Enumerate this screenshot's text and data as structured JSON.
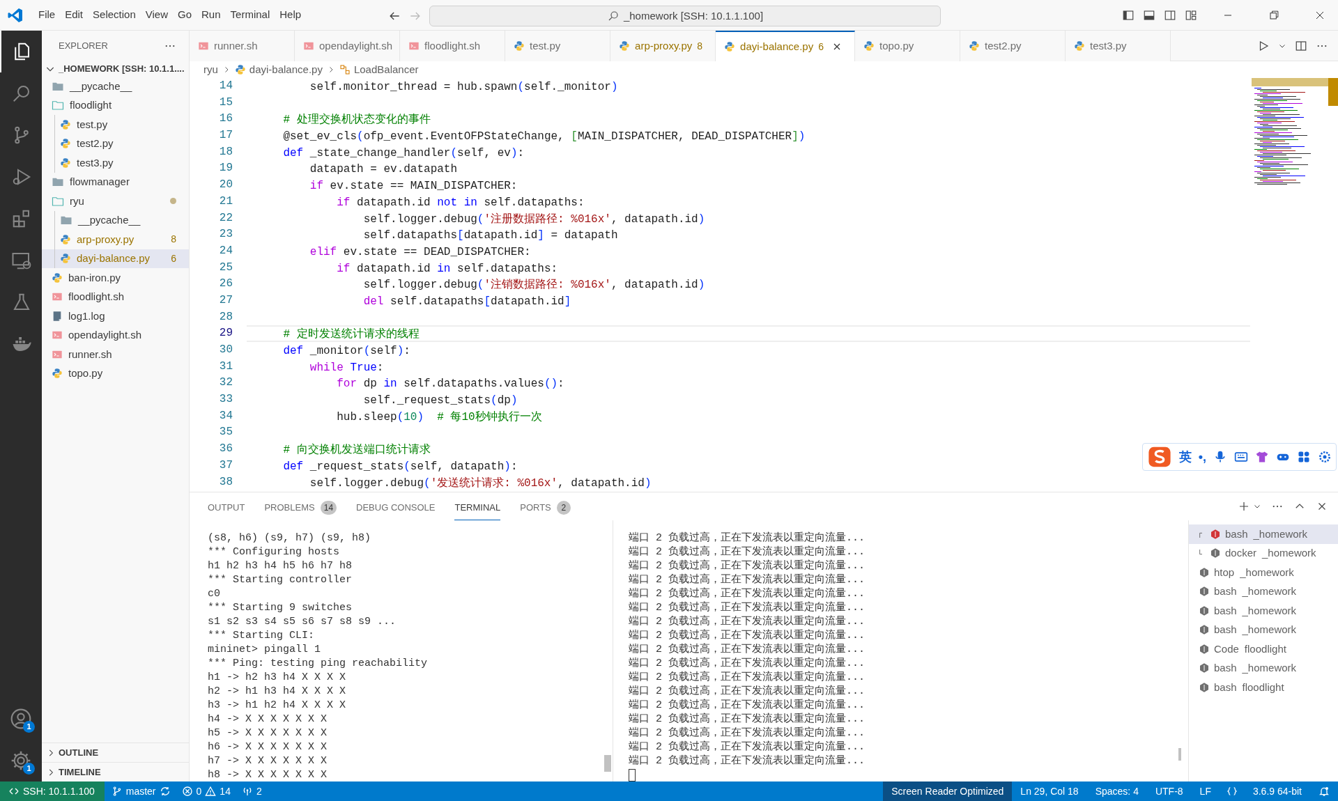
{
  "title_bar": {
    "menu": [
      "File",
      "Edit",
      "Selection",
      "View",
      "Go",
      "Run",
      "Terminal",
      "Help"
    ],
    "command_center": "_homework [SSH: 10.1.1.100]"
  },
  "activity_bar": [
    {
      "kind": "explorer",
      "selected": true
    },
    {
      "kind": "search",
      "selected": false
    },
    {
      "kind": "source-control",
      "selected": false
    },
    {
      "kind": "run",
      "selected": false
    },
    {
      "kind": "extensions",
      "selected": false
    },
    {
      "kind": "remote",
      "selected": false
    },
    {
      "kind": "testing",
      "selected": false
    },
    {
      "kind": "docker",
      "selected": false
    }
  ],
  "activity_bottom": [
    {
      "kind": "accounts",
      "badge": "1"
    },
    {
      "kind": "settings",
      "badge": "1"
    }
  ],
  "sidebar": {
    "title": "EXPLORER",
    "root": "_HOMEWORK [SSH: 10.1.1....",
    "tree": [
      {
        "label": "__pycache__",
        "kind": "folder",
        "expanded": false,
        "selected": false,
        "warning": false,
        "modified": false
      },
      {
        "label": "floodlight",
        "kind": "folder",
        "expanded": true,
        "selected": false,
        "warning": false,
        "modified": false,
        "children": [
          {
            "label": "test.py",
            "kind": "python",
            "selected": false,
            "warning": false,
            "modified": false
          },
          {
            "label": "test2.py",
            "kind": "python",
            "selected": false,
            "warning": false,
            "modified": false
          },
          {
            "label": "test3.py",
            "kind": "python",
            "selected": false,
            "warning": false,
            "modified": false
          }
        ]
      },
      {
        "label": "flowmanager",
        "kind": "folder",
        "expanded": false,
        "selected": false,
        "warning": false,
        "modified": false
      },
      {
        "label": "ryu",
        "kind": "folder",
        "expanded": true,
        "selected": false,
        "warning": false,
        "modified": true,
        "children": [
          {
            "label": "__pycache__",
            "kind": "folder",
            "expanded": false,
            "selected": false,
            "warning": false,
            "modified": false
          },
          {
            "label": "arp-proxy.py",
            "kind": "python",
            "selected": false,
            "warning": true,
            "modified": false,
            "badge": "8"
          },
          {
            "label": "dayi-balance.py",
            "kind": "python",
            "selected": true,
            "warning": true,
            "modified": false,
            "badge": "6"
          }
        ]
      },
      {
        "label": "ban-iron.py",
        "kind": "python",
        "selected": false,
        "warning": false,
        "modified": false
      },
      {
        "label": "floodlight.sh",
        "kind": "shell",
        "selected": false,
        "warning": false,
        "modified": false
      },
      {
        "label": "log1.log",
        "kind": "log",
        "selected": false,
        "warning": false,
        "modified": false
      },
      {
        "label": "opendaylight.sh",
        "kind": "shell",
        "selected": false,
        "warning": false,
        "modified": false
      },
      {
        "label": "runner.sh",
        "kind": "shell",
        "selected": false,
        "warning": false,
        "modified": false
      },
      {
        "label": "topo.py",
        "kind": "python",
        "selected": false,
        "warning": false,
        "modified": false
      }
    ],
    "sections": [
      "OUTLINE",
      "TIMELINE"
    ]
  },
  "tabs": [
    {
      "label": "runner.sh",
      "kind": "shell",
      "selected": false,
      "warning": false
    },
    {
      "label": "opendaylight.sh",
      "kind": "shell",
      "selected": false,
      "warning": false
    },
    {
      "label": "floodlight.sh",
      "kind": "shell",
      "selected": false,
      "warning": false
    },
    {
      "label": "test.py",
      "kind": "python",
      "selected": false,
      "warning": false
    },
    {
      "label": "arp-proxy.py",
      "kind": "python",
      "selected": false,
      "warning": true,
      "badge": "8"
    },
    {
      "label": "dayi-balance.py",
      "kind": "python",
      "selected": true,
      "warning": true,
      "badge": "6"
    },
    {
      "label": "topo.py",
      "kind": "python",
      "selected": false,
      "warning": false
    },
    {
      "label": "test2.py",
      "kind": "python",
      "selected": false,
      "warning": false
    },
    {
      "label": "test3.py",
      "kind": "python",
      "selected": false,
      "warning": false
    }
  ],
  "breadcrumb": [
    {
      "label": "ryu"
    },
    {
      "label": "dayi-balance.py",
      "kind": "python"
    },
    {
      "label": "LoadBalancer",
      "kind": "class"
    }
  ],
  "editor": {
    "lines": [
      {
        "number": "14",
        "current": false,
        "tokens": [
          {
            "kind": "plain",
            "text": "        self.monitor_thread = hub.spawn"
          },
          {
            "kind": "br",
            "text": "("
          },
          {
            "kind": "plain",
            "text": "self._monitor"
          },
          {
            "kind": "br",
            "text": ")"
          }
        ]
      },
      {
        "number": "15",
        "current": false
      },
      {
        "number": "16",
        "current": false,
        "tokens": [
          {
            "kind": "com",
            "text": "    # 处理交换机状态变化的事件"
          }
        ]
      },
      {
        "number": "17",
        "current": false,
        "tokens": [
          {
            "kind": "plain",
            "text": "    @set_ev_cls"
          },
          {
            "kind": "br",
            "text": "("
          },
          {
            "kind": "plain",
            "text": "ofp_event.EventOFPStateChange, "
          },
          {
            "kind": "br2",
            "text": "["
          },
          {
            "kind": "plain",
            "text": "MAIN_DISPATCHER, DEAD_DISPATCHER"
          },
          {
            "kind": "br2",
            "text": "]"
          },
          {
            "kind": "br",
            "text": ")"
          }
        ]
      },
      {
        "number": "18",
        "current": false,
        "tokens": [
          {
            "kind": "kw",
            "text": "    def"
          },
          {
            "kind": "plain",
            "text": " _state_change_handler"
          },
          {
            "kind": "br",
            "text": "("
          },
          {
            "kind": "plain",
            "text": "self, ev"
          },
          {
            "kind": "br",
            "text": ")"
          },
          {
            "kind": "plain",
            "text": ":"
          }
        ]
      },
      {
        "number": "19",
        "current": false,
        "tokens": [
          {
            "kind": "plain",
            "text": "        datapath = ev.datapath"
          }
        ]
      },
      {
        "number": "20",
        "current": false,
        "tokens": [
          {
            "kind": "ctl",
            "text": "        if"
          },
          {
            "kind": "plain",
            "text": " ev.state == MAIN_DISPATCHER:"
          }
        ]
      },
      {
        "number": "21",
        "current": false,
        "tokens": [
          {
            "kind": "ctl",
            "text": "            if"
          },
          {
            "kind": "plain",
            "text": " datapath.id "
          },
          {
            "kind": "kw",
            "text": "not in"
          },
          {
            "kind": "plain",
            "text": " self.datapaths:"
          }
        ]
      },
      {
        "number": "22",
        "current": false,
        "tokens": [
          {
            "kind": "plain",
            "text": "                self.logger.debug"
          },
          {
            "kind": "br",
            "text": "("
          },
          {
            "kind": "str",
            "text": "'注册数据路径: %016x'"
          },
          {
            "kind": "plain",
            "text": ", datapath.id"
          },
          {
            "kind": "br",
            "text": ")"
          }
        ]
      },
      {
        "number": "23",
        "current": false,
        "tokens": [
          {
            "kind": "plain",
            "text": "                self.datapaths"
          },
          {
            "kind": "br",
            "text": "["
          },
          {
            "kind": "plain",
            "text": "datapath.id"
          },
          {
            "kind": "br",
            "text": "]"
          },
          {
            "kind": "plain",
            "text": " = datapath"
          }
        ]
      },
      {
        "number": "24",
        "current": false,
        "tokens": [
          {
            "kind": "ctl",
            "text": "        elif"
          },
          {
            "kind": "plain",
            "text": " ev.state == DEAD_DISPATCHER:"
          }
        ]
      },
      {
        "number": "25",
        "current": false,
        "tokens": [
          {
            "kind": "ctl",
            "text": "            if"
          },
          {
            "kind": "plain",
            "text": " datapath.id "
          },
          {
            "kind": "kw",
            "text": "in"
          },
          {
            "kind": "plain",
            "text": " self.datapaths:"
          }
        ]
      },
      {
        "number": "26",
        "current": false,
        "tokens": [
          {
            "kind": "plain",
            "text": "                self.logger.debug"
          },
          {
            "kind": "br",
            "text": "("
          },
          {
            "kind": "str",
            "text": "'注销数据路径: %016x'"
          },
          {
            "kind": "plain",
            "text": ", datapath.id"
          },
          {
            "kind": "br",
            "text": ")"
          }
        ]
      },
      {
        "number": "27",
        "current": false,
        "tokens": [
          {
            "kind": "ctl",
            "text": "                del"
          },
          {
            "kind": "plain",
            "text": " self.datapaths"
          },
          {
            "kind": "br",
            "text": "["
          },
          {
            "kind": "plain",
            "text": "datapath.id"
          },
          {
            "kind": "br",
            "text": "]"
          }
        ]
      },
      {
        "number": "28",
        "current": false
      },
      {
        "number": "29",
        "current": true,
        "tokens": [
          {
            "kind": "com",
            "text": "    # 定时发送统计请求的线程"
          }
        ]
      },
      {
        "number": "30",
        "current": false,
        "tokens": [
          {
            "kind": "kw",
            "text": "    def"
          },
          {
            "kind": "plain",
            "text": " _monitor"
          },
          {
            "kind": "br",
            "text": "("
          },
          {
            "kind": "plain",
            "text": "self"
          },
          {
            "kind": "br",
            "text": ")"
          },
          {
            "kind": "plain",
            "text": ":"
          }
        ]
      },
      {
        "number": "31",
        "current": false,
        "tokens": [
          {
            "kind": "ctl",
            "text": "        while"
          },
          {
            "kind": "kw",
            "text": " True"
          },
          {
            "kind": "plain",
            "text": ":"
          }
        ]
      },
      {
        "number": "32",
        "current": false,
        "tokens": [
          {
            "kind": "ctl",
            "text": "            for"
          },
          {
            "kind": "plain",
            "text": " dp "
          },
          {
            "kind": "kw",
            "text": "in"
          },
          {
            "kind": "plain",
            "text": " self.datapaths.values"
          },
          {
            "kind": "br",
            "text": "()"
          },
          {
            "kind": "plain",
            "text": ":"
          }
        ]
      },
      {
        "number": "33",
        "current": false,
        "tokens": [
          {
            "kind": "plain",
            "text": "                self._request_stats"
          },
          {
            "kind": "br",
            "text": "("
          },
          {
            "kind": "plain",
            "text": "dp"
          },
          {
            "kind": "br",
            "text": ")"
          }
        ]
      },
      {
        "number": "34",
        "current": false,
        "tokens": [
          {
            "kind": "plain",
            "text": "            hub.sleep"
          },
          {
            "kind": "br",
            "text": "("
          },
          {
            "kind": "num",
            "text": "10"
          },
          {
            "kind": "br",
            "text": ")"
          },
          {
            "kind": "com",
            "text": "  # 每10秒钟执行一次"
          }
        ]
      },
      {
        "number": "35",
        "current": false
      },
      {
        "number": "36",
        "current": false,
        "tokens": [
          {
            "kind": "com",
            "text": "    # 向交换机发送端口统计请求"
          }
        ]
      },
      {
        "number": "37",
        "current": false,
        "tokens": [
          {
            "kind": "kw",
            "text": "    def"
          },
          {
            "kind": "plain",
            "text": " _request_stats"
          },
          {
            "kind": "br",
            "text": "("
          },
          {
            "kind": "plain",
            "text": "self, datapath"
          },
          {
            "kind": "br",
            "text": ")"
          },
          {
            "kind": "plain",
            "text": ":"
          }
        ]
      },
      {
        "number": "38",
        "current": false,
        "tokens": [
          {
            "kind": "plain",
            "text": "        self.logger.debug"
          },
          {
            "kind": "br",
            "text": "("
          },
          {
            "kind": "str",
            "text": "'发送统计请求: %016x'"
          },
          {
            "kind": "plain",
            "text": ", datapath.id"
          },
          {
            "kind": "br",
            "text": ")"
          }
        ]
      }
    ]
  },
  "ime_toolbar": {
    "mode": "英",
    "punctuation": "•,"
  },
  "panel": {
    "tabs": [
      {
        "label": "OUTPUT",
        "selected": false
      },
      {
        "label": "PROBLEMS",
        "selected": false,
        "count": "14"
      },
      {
        "label": "DEBUG CONSOLE",
        "selected": false
      },
      {
        "label": "TERMINAL",
        "selected": true
      },
      {
        "label": "PORTS",
        "selected": false,
        "count": "2"
      }
    ],
    "terminal_left": [
      "(s8, h6) (s9, h7) (s9, h8)",
      "*** Configuring hosts",
      "h1 h2 h3 h4 h5 h6 h7 h8",
      "*** Starting controller",
      "c0",
      "*** Starting 9 switches",
      "s1 s2 s3 s4 s5 s6 s7 s8 s9 ...",
      "*** Starting CLI:",
      "mininet> pingall 1",
      "*** Ping: testing ping reachability",
      "h1 -> h2 h3 h4 X X X X",
      "h2 -> h1 h3 h4 X X X X",
      "h3 -> h1 h2 h4 X X X X",
      "h4 -> X X X X X X X",
      "h5 -> X X X X X X X",
      "h6 -> X X X X X X X",
      "h7 -> X X X X X X X",
      "h8 -> X X X X X X X"
    ],
    "terminal_right": [
      "端口 2 负载过高，正在下发流表以重定向流量...",
      "端口 2 负载过高，正在下发流表以重定向流量...",
      "端口 2 负载过高，正在下发流表以重定向流量...",
      "端口 2 负载过高，正在下发流表以重定向流量...",
      "端口 2 负载过高，正在下发流表以重定向流量...",
      "端口 2 负载过高，正在下发流表以重定向流量...",
      "端口 2 负载过高，正在下发流表以重定向流量...",
      "端口 2 负载过高，正在下发流表以重定向流量...",
      "端口 2 负载过高，正在下发流表以重定向流量...",
      "端口 2 负载过高，正在下发流表以重定向流量...",
      "端口 2 负载过高，正在下发流表以重定向流量...",
      "端口 2 负载过高，正在下发流表以重定向流量...",
      "端口 2 负载过高，正在下发流表以重定向流量...",
      "端口 2 负载过高，正在下发流表以重定向流量...",
      "端口 2 负载过高，正在下发流表以重定向流量...",
      "端口 2 负载过高，正在下发流表以重定向流量...",
      "端口 2 负载过高，正在下发流表以重定向流量..."
    ],
    "terminals": [
      {
        "name": "bash",
        "folder": "_homework",
        "selected": true,
        "children": [
          {
            "name": "docker",
            "folder": "_homework",
            "selected": false
          }
        ]
      },
      {
        "name": "htop",
        "folder": "_homework",
        "selected": false
      },
      {
        "name": "bash",
        "folder": "_homework",
        "selected": false
      },
      {
        "name": "bash",
        "folder": "_homework",
        "selected": false
      },
      {
        "name": "bash",
        "folder": "_homework",
        "selected": false
      },
      {
        "name": "Code",
        "folder": "floodlight",
        "selected": false
      },
      {
        "name": "bash",
        "folder": "_homework",
        "selected": false
      },
      {
        "name": "bash",
        "folder": "floodlight",
        "selected": false
      }
    ]
  },
  "status_bar": {
    "remote": "SSH: 10.1.1.100",
    "branch": "master",
    "errors": "0",
    "warnings": "14",
    "ports": "2",
    "screen_reader": "Screen Reader Optimized",
    "position": "Ln 29, Col 18",
    "indentation": "Spaces: 4",
    "encoding": "UTF-8",
    "eol": "LF",
    "interpreter": "3.6.9 64-bit"
  }
}
